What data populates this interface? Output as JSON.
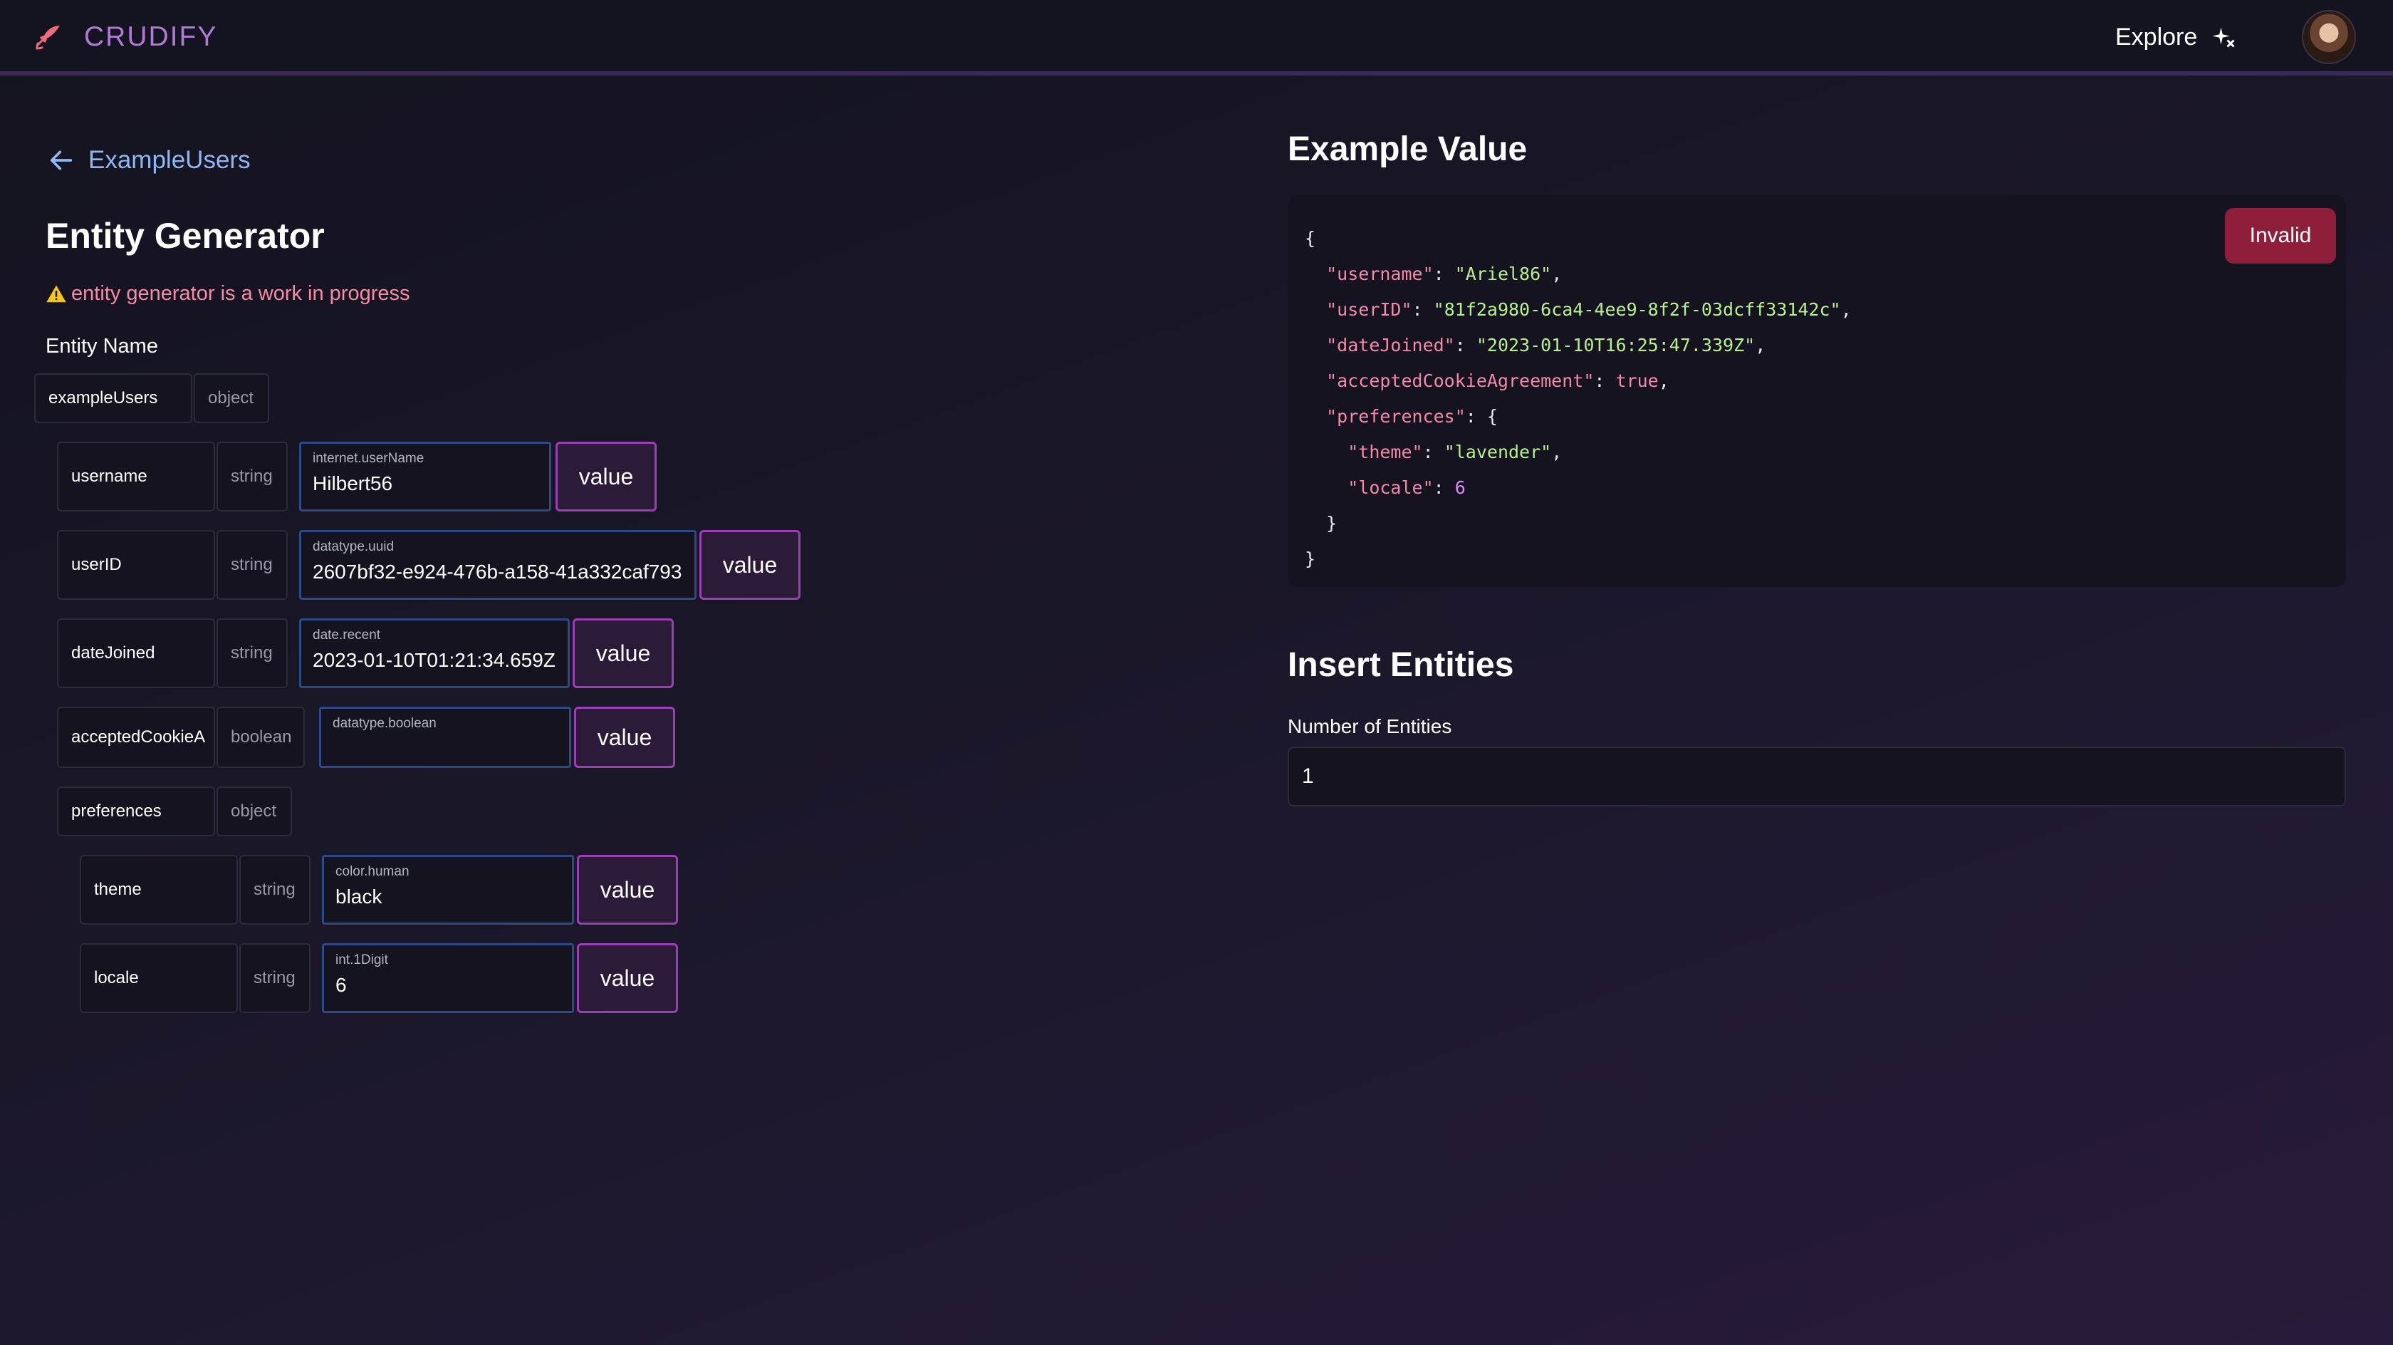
{
  "header": {
    "brand": "CRUDIFY",
    "explore_label": "Explore",
    "icons": {
      "brand": "rocket-icon",
      "explore": "sparkles-icon"
    },
    "accent_color": "#b079d6"
  },
  "nav": {
    "back_label": "ExampleUsers"
  },
  "generator": {
    "title": "Entity Generator",
    "warning": "entity generator is a work in progress",
    "entity_name_label": "Entity Name",
    "root": {
      "name": "exampleUsers",
      "type": "object"
    },
    "fields": [
      {
        "name": "username",
        "type": "string",
        "generator": "internet.userName",
        "value": "Hilbert56",
        "button": "value"
      },
      {
        "name": "userID",
        "type": "string",
        "generator": "datatype.uuid",
        "value": "2607bf32-e924-476b-a158-41a332caf793",
        "button": "value"
      },
      {
        "name": "dateJoined",
        "type": "string",
        "generator": "date.recent",
        "value": "2023-01-10T01:21:34.659Z",
        "button": "value"
      },
      {
        "name": "acceptedCookieA",
        "type": "boolean",
        "generator": "datatype.boolean",
        "value": "",
        "button": "value"
      }
    ],
    "nested": {
      "name": "preferences",
      "type": "object"
    },
    "nested_fields": [
      {
        "name": "theme",
        "type": "string",
        "generator": "color.human",
        "value": "black",
        "button": "value"
      },
      {
        "name": "locale",
        "type": "string",
        "generator": "int.1Digit",
        "value": "6",
        "button": "value"
      }
    ]
  },
  "example": {
    "title": "Example Value",
    "invalid_label": "Invalid",
    "code": {
      "open": "{",
      "username_key": "\"username\"",
      "username_val": "\"Ariel86\"",
      "userid_key": "\"userID\"",
      "userid_val": "\"81f2a980-6ca4-4ee9-8f2f-03dcff33142c\"",
      "date_key": "\"dateJoined\"",
      "date_val": "\"2023-01-10T16:25:47.339Z\"",
      "cookie_key": "\"acceptedCookieAgreement\"",
      "cookie_val": "true",
      "pref_key": "\"preferences\"",
      "theme_key": "\"theme\"",
      "theme_val": "\"lavender\"",
      "locale_key": "\"locale\"",
      "locale_val": "6",
      "inner_close": "}",
      "close": "}"
    }
  },
  "insert": {
    "title": "Insert Entities",
    "count_label": "Number of Entities",
    "count_value": "1"
  }
}
